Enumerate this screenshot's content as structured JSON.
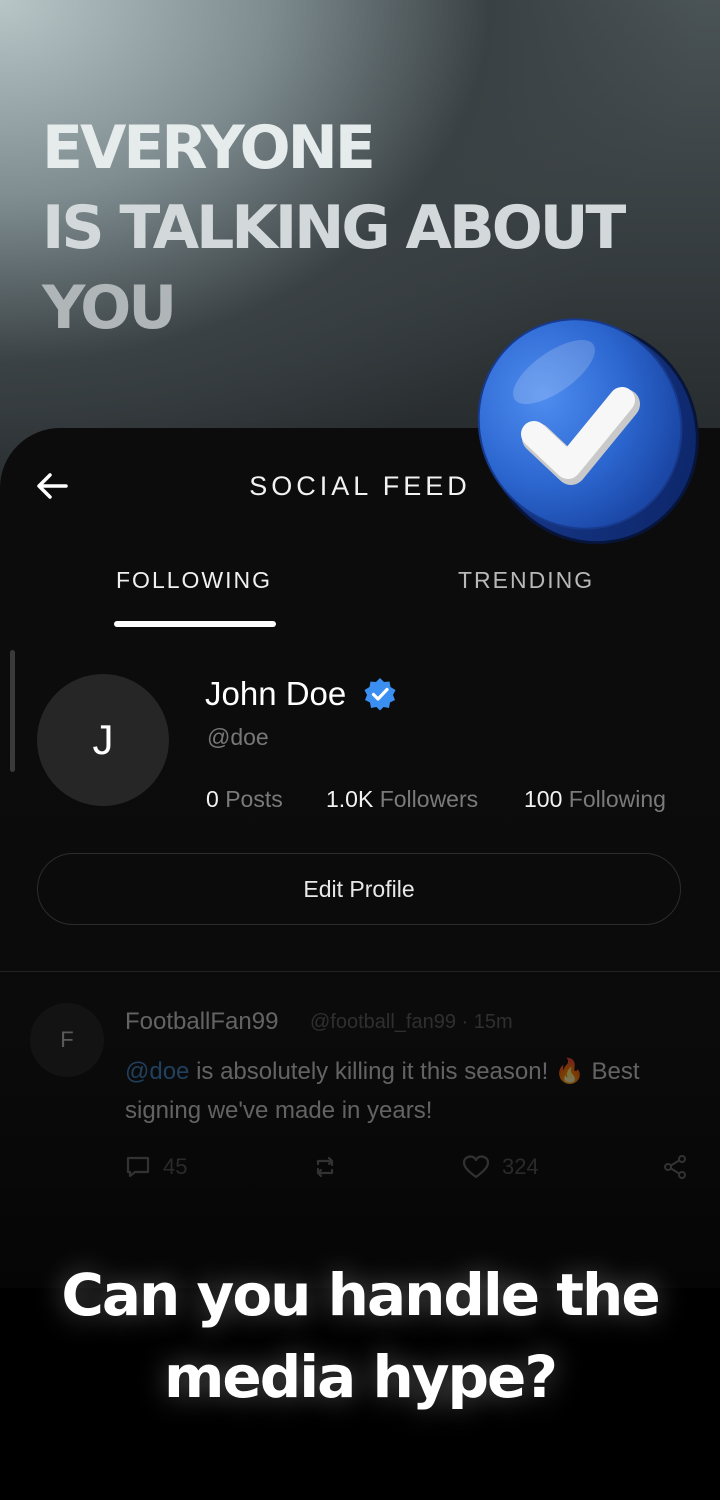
{
  "headline": {
    "line1": "EVERYONE",
    "line2": "IS TALKING ABOUT",
    "line3": "YOU"
  },
  "header": {
    "title": "SOCIAL FEED",
    "back_icon": "arrow-left-icon"
  },
  "tabs": [
    {
      "label": "FOLLOWING",
      "active": true
    },
    {
      "label": "TRENDING",
      "active": false
    }
  ],
  "profile": {
    "avatar_initial": "J",
    "name": "John Doe",
    "handle": "@doe",
    "verified": true,
    "stats": {
      "posts_value": "0",
      "posts_label": "Posts",
      "followers_value": "1.0K",
      "followers_label": "Followers",
      "following_value": "100",
      "following_label": "Following"
    },
    "edit_button_label": "Edit Profile"
  },
  "post": {
    "avatar_initial": "F",
    "author": "FootballFan99",
    "meta": "@football_fan99 · 15m",
    "mention": "@doe",
    "body_rest": " is absolutely killing it this season! 🔥 Best signing we've made in years!",
    "reply_count": "45",
    "like_count": "324"
  },
  "cta": {
    "line1": "Can you handle the",
    "line2": "media hype?"
  },
  "colors": {
    "accent_blue": "#2f6fd6",
    "verified_blue": "#3b8ff0",
    "mention_blue": "#3b82c4"
  }
}
